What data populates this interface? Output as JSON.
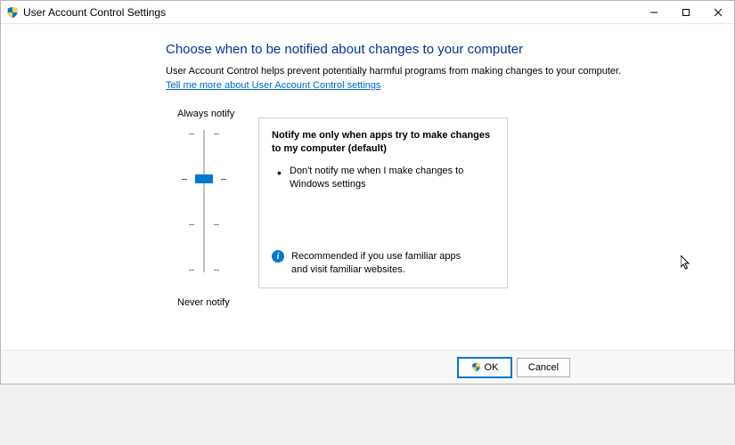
{
  "window": {
    "title": "User Account Control Settings"
  },
  "main": {
    "heading": "Choose when to be notified about changes to your computer",
    "description": "User Account Control helps prevent potentially harmful programs from making changes to your computer.",
    "link": "Tell me more about User Account Control settings"
  },
  "slider": {
    "top_label": "Always notify",
    "bottom_label": "Never notify",
    "level": 2
  },
  "info": {
    "title": "Notify me only when apps try to make changes to my computer (default)",
    "bullet1": "Don't notify me when I make changes to Windows settings",
    "recommend": "Recommended if you use familiar apps and visit familiar websites."
  },
  "footer": {
    "ok": "OK",
    "cancel": "Cancel"
  }
}
